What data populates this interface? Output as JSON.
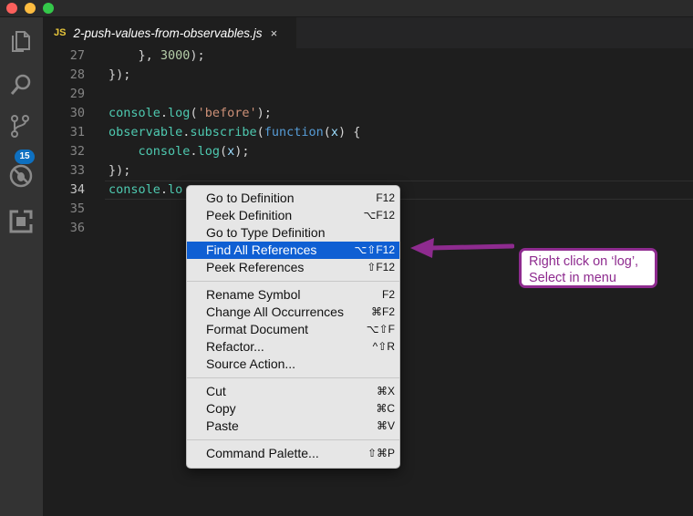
{
  "window": {
    "tab": {
      "lang_badge": "JS",
      "title": "2-push-values-from-observables.js",
      "close_glyph": "×"
    },
    "activity_badge": "15"
  },
  "editor": {
    "lines": [
      {
        "num": "27",
        "tokens": [
          {
            "t": "    }, ",
            "c": "plain"
          },
          {
            "t": "3000",
            "c": "num"
          },
          {
            "t": ");",
            "c": "plain"
          }
        ]
      },
      {
        "num": "28",
        "tokens": [
          {
            "t": "});",
            "c": "plain"
          }
        ]
      },
      {
        "num": "29",
        "tokens": []
      },
      {
        "num": "30",
        "tokens": [
          {
            "t": "console",
            "c": "id"
          },
          {
            "t": ".",
            "c": "plain"
          },
          {
            "t": "log",
            "c": "id"
          },
          {
            "t": "(",
            "c": "plain"
          },
          {
            "t": "'before'",
            "c": "str"
          },
          {
            "t": ");",
            "c": "plain"
          }
        ]
      },
      {
        "num": "31",
        "tokens": [
          {
            "t": "observable",
            "c": "id"
          },
          {
            "t": ".",
            "c": "plain"
          },
          {
            "t": "subscribe",
            "c": "id"
          },
          {
            "t": "(",
            "c": "plain"
          },
          {
            "t": "function",
            "c": "kw"
          },
          {
            "t": "(",
            "c": "plain"
          },
          {
            "t": "x",
            "c": "var"
          },
          {
            "t": ") {",
            "c": "plain"
          }
        ]
      },
      {
        "num": "32",
        "tokens": [
          {
            "t": "    ",
            "c": "plain"
          },
          {
            "t": "console",
            "c": "id"
          },
          {
            "t": ".",
            "c": "plain"
          },
          {
            "t": "log",
            "c": "id"
          },
          {
            "t": "(",
            "c": "plain"
          },
          {
            "t": "x",
            "c": "var"
          },
          {
            "t": ");",
            "c": "plain"
          }
        ]
      },
      {
        "num": "33",
        "tokens": [
          {
            "t": "});",
            "c": "plain"
          }
        ]
      },
      {
        "num": "34",
        "active": true,
        "tokens": [
          {
            "t": "console",
            "c": "id"
          },
          {
            "t": ".",
            "c": "plain"
          },
          {
            "t": "lo",
            "c": "id"
          }
        ]
      },
      {
        "num": "35",
        "tokens": []
      },
      {
        "num": "36",
        "tokens": []
      }
    ]
  },
  "context_menu": {
    "groups": [
      [
        {
          "label": "Go to Definition",
          "shortcut": "F12"
        },
        {
          "label": "Peek Definition",
          "shortcut": "⌥F12"
        },
        {
          "label": "Go to Type Definition",
          "shortcut": ""
        },
        {
          "label": "Find All References",
          "shortcut": "⌥⇧F12",
          "selected": true
        },
        {
          "label": "Peek References",
          "shortcut": "⇧F12"
        }
      ],
      [
        {
          "label": "Rename Symbol",
          "shortcut": "F2"
        },
        {
          "label": "Change All Occurrences",
          "shortcut": "⌘F2"
        },
        {
          "label": "Format Document",
          "shortcut": "⌥⇧F"
        },
        {
          "label": "Refactor...",
          "shortcut": "^⇧R"
        },
        {
          "label": "Source Action...",
          "shortcut": ""
        }
      ],
      [
        {
          "label": "Cut",
          "shortcut": "⌘X"
        },
        {
          "label": "Copy",
          "shortcut": "⌘C"
        },
        {
          "label": "Paste",
          "shortcut": "⌘V"
        }
      ],
      [
        {
          "label": "Command Palette...",
          "shortcut": "⇧⌘P"
        }
      ]
    ]
  },
  "annotation": {
    "line1": "Right click on ‘log’,",
    "line2": "Select in menu",
    "color": "#8e2b8f"
  },
  "icons": [
    "files-icon",
    "search-icon",
    "source-control-icon",
    "debug-icon",
    "extensions-icon",
    "arrow-annotation-icon"
  ]
}
